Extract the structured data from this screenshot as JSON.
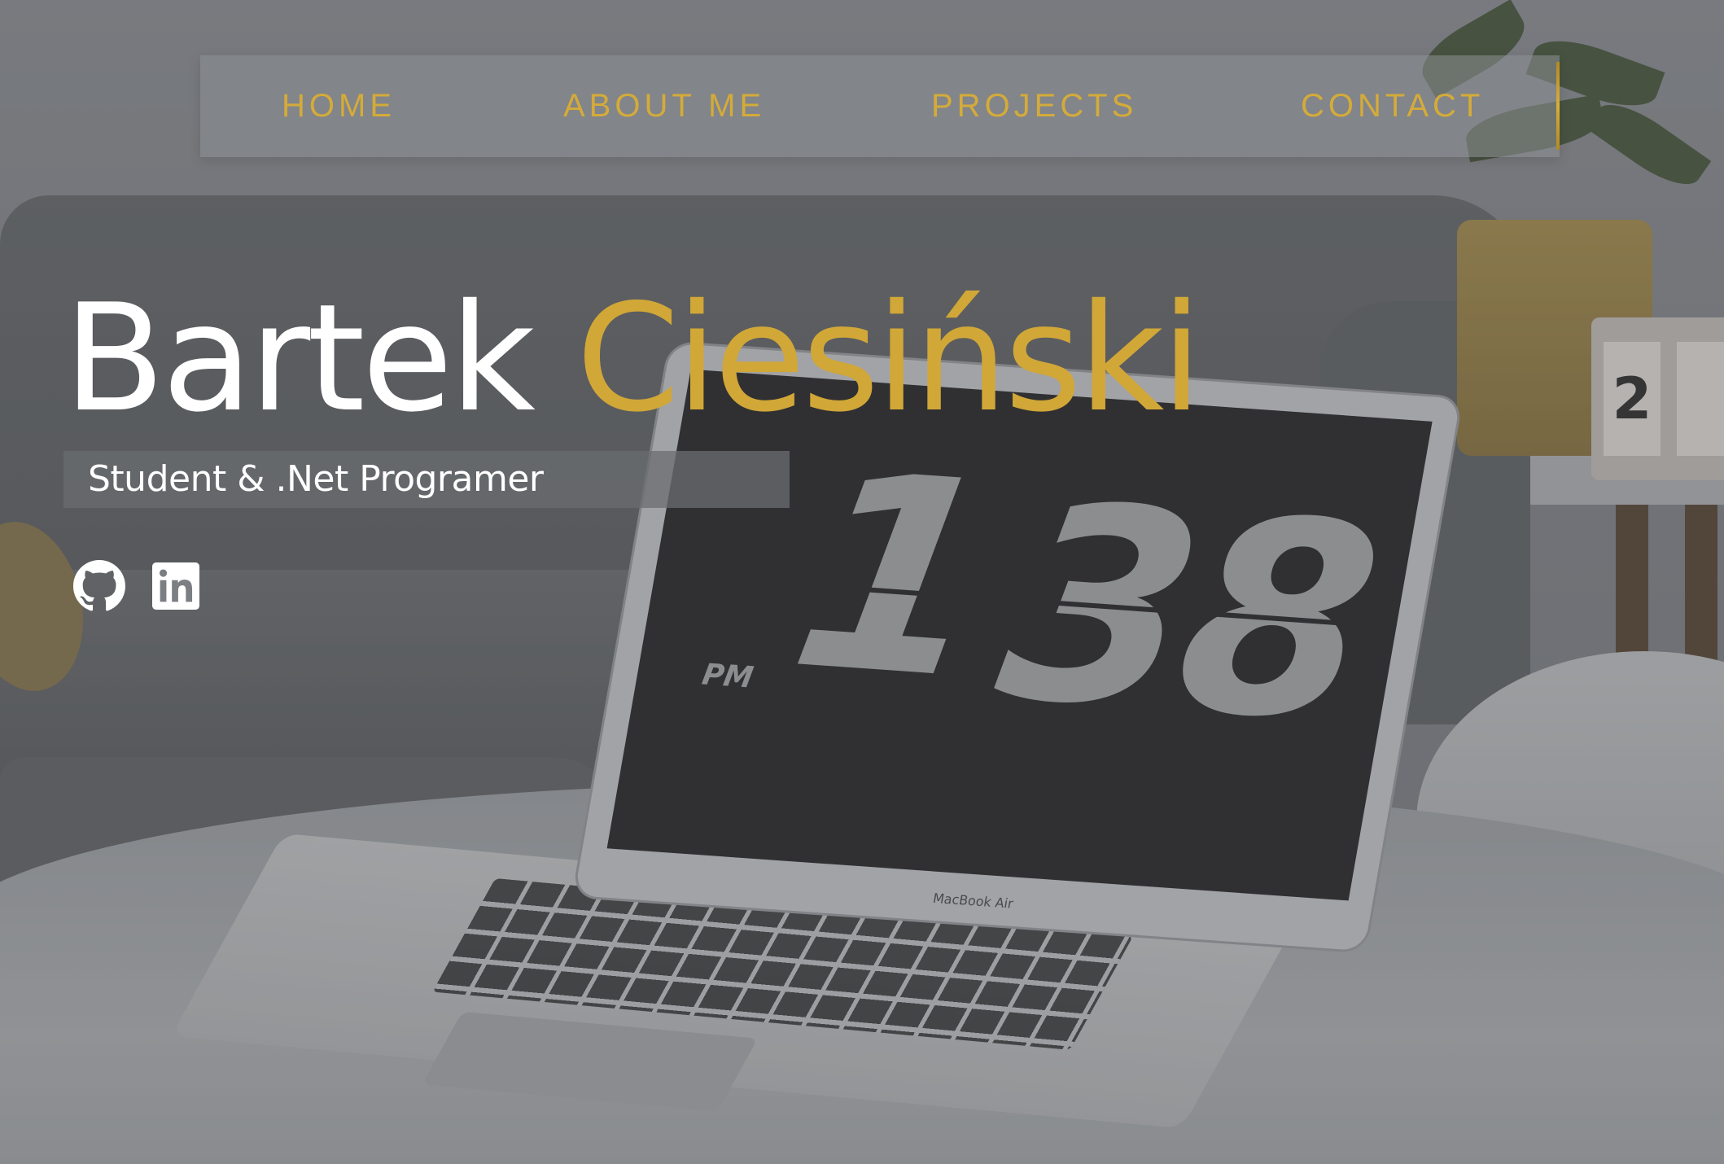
{
  "nav": {
    "items": [
      {
        "label": "HOME"
      },
      {
        "label": "ABOUT ME"
      },
      {
        "label": "PROJECTS"
      },
      {
        "label": "CONTACT"
      }
    ]
  },
  "hero": {
    "first_name": "Bartek",
    "last_name": "Ciesiński",
    "subtitle": "Student & .Net Programer"
  },
  "social": [
    {
      "icon": "github-icon"
    },
    {
      "icon": "linkedin-icon"
    }
  ],
  "background": {
    "clock_hour": "1",
    "clock_minute": "38",
    "clock_period": "PM",
    "laptop_brand": "MacBook Air",
    "calendar_digit": "2"
  },
  "colors": {
    "accent": "#d1a737",
    "nav_text": "#d4ab3a",
    "name_first": "#ffffff"
  }
}
